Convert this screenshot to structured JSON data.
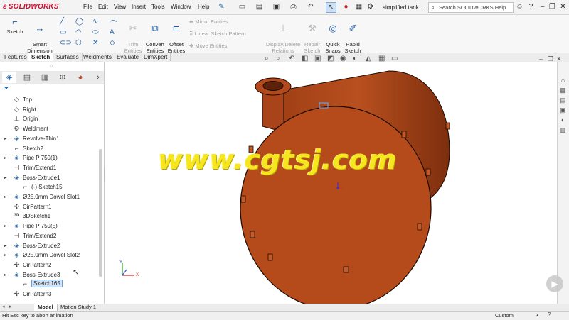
{
  "app": {
    "logo_text": "SOLIDWORKS",
    "document_title": "simplified tank....",
    "search_placeholder": "Search SOLIDWORKS Help"
  },
  "menu": [
    "File",
    "Edit",
    "View",
    "Insert",
    "Tools",
    "Window",
    "Help"
  ],
  "command_manager": {
    "sketch": "Sketch",
    "smart_dimension": "Smart\nDimension",
    "trim": "Trim\nEntities",
    "convert": "Convert\nEntities",
    "offset": "Offset\nEntities",
    "mirror": "Mirror Entities",
    "linear_pattern": "Linear Sketch Pattern",
    "move": "Move Entities",
    "display_delete": "Display/Delete\nRelations",
    "repair": "Repair\nSketch",
    "quick_snaps": "Quick\nSnaps",
    "rapid_sketch": "Rapid\nSketch"
  },
  "tabs": [
    "Features",
    "Sketch",
    "Surfaces",
    "Weldments",
    "Evaluate",
    "DimXpert"
  ],
  "active_tab": "Sketch",
  "tree": [
    {
      "label": "Top",
      "icon": "plane",
      "expandable": false,
      "indent": 1
    },
    {
      "label": "Right",
      "icon": "plane",
      "expandable": false,
      "indent": 1
    },
    {
      "label": "Origin",
      "icon": "origin",
      "expandable": false,
      "indent": 1
    },
    {
      "label": "Weldment",
      "icon": "weldment",
      "expandable": false,
      "indent": 1
    },
    {
      "label": "Revolve-Thin1",
      "icon": "feature",
      "expandable": true,
      "indent": 1
    },
    {
      "label": "Sketch2",
      "icon": "sketch",
      "expandable": false,
      "indent": 1
    },
    {
      "label": "Pipe P 750(1)",
      "icon": "feature",
      "expandable": true,
      "indent": 1
    },
    {
      "label": "Trim/Extend1",
      "icon": "trim",
      "expandable": false,
      "indent": 1
    },
    {
      "label": "Boss-Extrude1",
      "icon": "feature",
      "expandable": true,
      "indent": 1
    },
    {
      "label": "(-) Sketch15",
      "icon": "sketch",
      "expandable": false,
      "indent": 2
    },
    {
      "label": "Ø25.0mm Dowel Slot1",
      "icon": "feature",
      "expandable": true,
      "indent": 1
    },
    {
      "label": "CirPattern1",
      "icon": "pattern",
      "expandable": false,
      "indent": 1
    },
    {
      "label": "3DSketch1",
      "icon": "3d",
      "expandable": false,
      "indent": 1
    },
    {
      "label": "Pipe P 750(5)",
      "icon": "feature",
      "expandable": true,
      "indent": 1
    },
    {
      "label": "Trim/Extend2",
      "icon": "trim",
      "expandable": false,
      "indent": 1
    },
    {
      "label": "Boss-Extrude2",
      "icon": "feature",
      "expandable": true,
      "indent": 1
    },
    {
      "label": "Ø25.0mm Dowel Slot2",
      "icon": "feature",
      "expandable": true,
      "indent": 1
    },
    {
      "label": "CirPattern2",
      "icon": "pattern",
      "expandable": false,
      "indent": 1
    },
    {
      "label": "Boss-Extrude3",
      "icon": "feature",
      "expandable": true,
      "indent": 1
    },
    {
      "label": "Sketch165",
      "icon": "sketch",
      "expandable": false,
      "indent": 2,
      "selected": true
    },
    {
      "label": "CirPattern3",
      "icon": "pattern",
      "expandable": false,
      "indent": 1
    }
  ],
  "bottom_tabs": [
    "Model",
    "Motion Study 1"
  ],
  "active_bottom_tab": "Model",
  "status": {
    "message": "Hit Esc key to abort animation",
    "units": "Custom"
  },
  "axis_labels": {
    "x": "X",
    "y": "Y"
  },
  "watermark": "www.cgtsj.com",
  "colors": {
    "tank": "#b54a1a",
    "tank_dark": "#8a3412",
    "accent_blue": "#1d5fa8",
    "logo_red": "#c8102e",
    "watermark": "#f5e61f"
  }
}
